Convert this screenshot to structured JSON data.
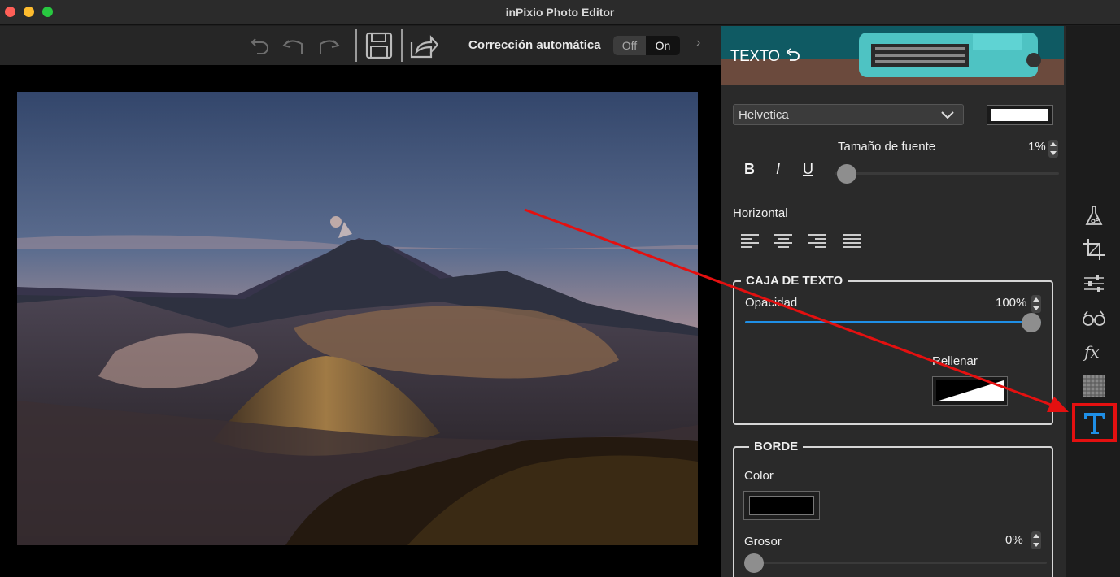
{
  "window": {
    "title": "inPixio Photo Editor"
  },
  "toolbar": {
    "icons": [
      "undo-icon",
      "undo-step-icon",
      "redo-icon",
      "save-icon",
      "share-icon"
    ],
    "auto_correction_label": "Corrección automática",
    "toggle": {
      "off_label": "Off",
      "on_label": "On",
      "selected": "Off"
    }
  },
  "panel": {
    "banner_title": "TEXTO",
    "font": {
      "selected": "Helvetica"
    },
    "text_color": "#ffffff",
    "font_size": {
      "label": "Tamaño de fuente",
      "value": "1%"
    },
    "styles": {
      "bold": "B",
      "italic": "I",
      "underline": "U"
    },
    "horizontal_label": "Horizontal",
    "align_icons": [
      "align-left-icon",
      "align-center-icon",
      "align-right-icon",
      "align-justify-icon"
    ],
    "text_box": {
      "title": "CAJA DE TEXTO",
      "opacity_label": "Opacidad",
      "opacity_value": "100%",
      "opacity_level": 1.0,
      "fill_label": "Rellenar"
    },
    "border": {
      "title": "BORDE",
      "color_label": "Color",
      "color_value": "#000000",
      "thickness_label": "Grosor",
      "thickness_value": "0%",
      "thickness_level": 0
    }
  },
  "rail": {
    "tools": [
      "flask-icon",
      "crop-icon",
      "sliders-icon",
      "glasses-icon",
      "fx-icon",
      "texture-icon",
      "text-tool-icon"
    ],
    "active_tool": "text-tool-icon"
  },
  "colors": {
    "accent": "#1f8fe6",
    "highlight": "#e41010",
    "panel": "#2a2a2a"
  }
}
